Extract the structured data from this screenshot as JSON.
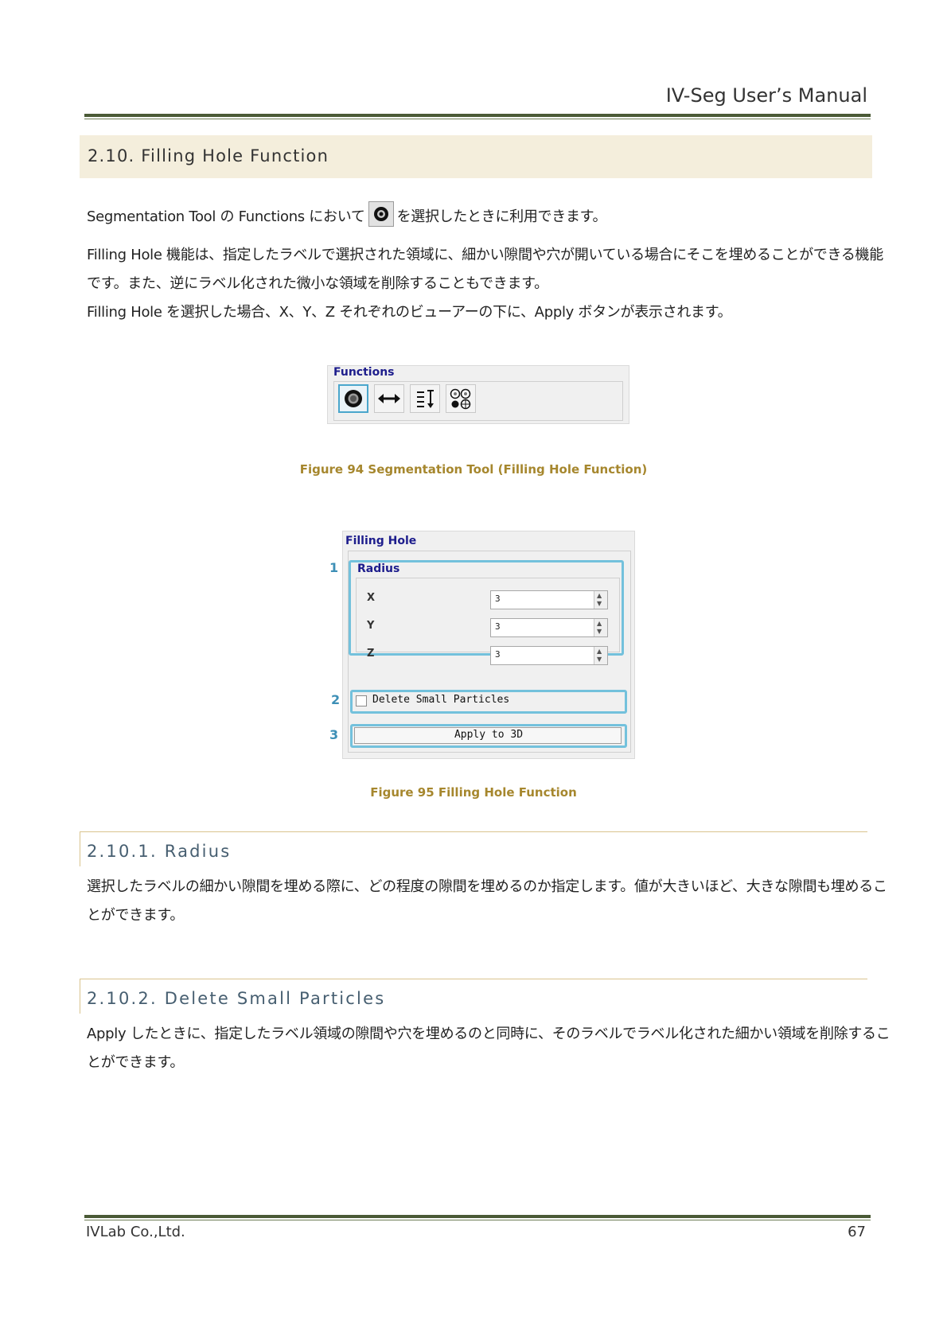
{
  "header": {
    "title": "IV-Seg User’s Manual"
  },
  "section": {
    "title": "2.10. Filling Hole Function"
  },
  "paragraphs": {
    "p1_before": "Segmentation Tool の Functions において",
    "p1_after": "を選択したときに利用できます。",
    "p2_line1": "Filling Hole 機能は、指定したラベルで選択された領域に、細かい隙間や穴が開いている場合にそこを埋めることができる機能",
    "p2_line2": "です。また、逆にラベル化された微小な領域を削除することもできます。",
    "p3": "Filling Hole を選択した場合、X、Y、Z それぞれのビューアーの下に、Apply ボタンが表示されます。"
  },
  "functions_panel": {
    "title": "Functions",
    "buttons": [
      {
        "icon": "filling-hole-icon"
      },
      {
        "icon": "horizontal-arrows-icon"
      },
      {
        "icon": "vertical-range-icon"
      },
      {
        "icon": "particles-icon"
      }
    ]
  },
  "figure94": {
    "caption": "Figure 94 Segmentation Tool (Filling Hole Function)"
  },
  "filling_panel": {
    "title": "Filling Hole",
    "radius_group": "Radius",
    "rows": [
      {
        "axis": "X",
        "value": "3"
      },
      {
        "axis": "Y",
        "value": "3"
      },
      {
        "axis": "Z",
        "value": "3"
      }
    ],
    "checkbox_label": "Delete Small Particles",
    "checkbox_checked": false,
    "apply_label": "Apply to 3D",
    "callouts": [
      "1",
      "2",
      "3"
    ]
  },
  "figure95": {
    "caption": "Figure 95 Filling Hole Function"
  },
  "sub1": {
    "title": "2.10.1.  Radius",
    "line1": "選択したラベルの細かい隙間を埋める際に、どの程度の隙間を埋めるのか指定します。値が大きいほど、大きな隙間も埋めるこ",
    "line2": "とができます。"
  },
  "sub2": {
    "title": "2.10.2.  Delete Small Particles",
    "line1": "Apply したときに、指定したラベル領域の隙間や穴を埋めるのと同時に、そのラベルでラベル化された細かい領域を削除するこ",
    "line2": "とができます。"
  },
  "footer": {
    "company": "IVLab Co.,Ltd.",
    "page": "67"
  },
  "colors": {
    "accent_rule": "#4a5a36",
    "section_band": "#f4eedc",
    "caption": "#a6872e",
    "subsection_line": "#d9c48e",
    "highlight_box": "#73c1dc",
    "callout_number": "#3d8fb6"
  }
}
